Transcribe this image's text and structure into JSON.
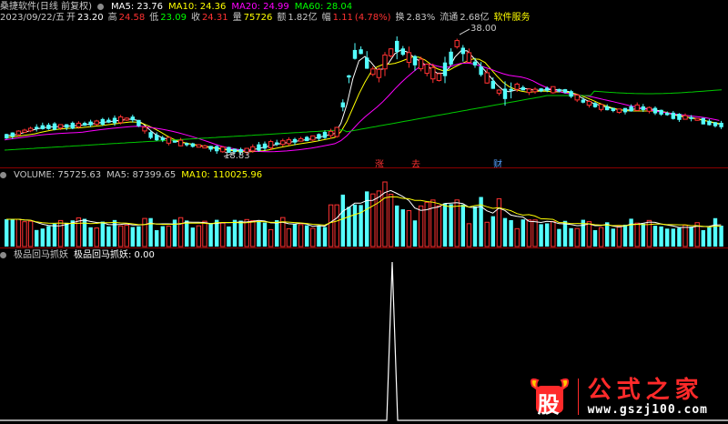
{
  "info_line": {
    "date": "2023/09/22/五",
    "open_label": "开",
    "open": "23.20",
    "high_label": "高",
    "high": "24.58",
    "low_label": "低",
    "low": "23.09",
    "close_label": "收",
    "close": "24.31",
    "vol_label": "量",
    "vol": "75726",
    "amount_label": "额",
    "amount": "1.82亿",
    "change_label": "幅",
    "change": "1.11",
    "change_pct": "(4.78%)",
    "turnover_label": "换",
    "turnover": "2.83%",
    "float_label": "流通",
    "float": "2.68亿",
    "service": "软件服务"
  },
  "price_panel": {
    "title": "桑捷软件(日线 前复权)",
    "ma": [
      {
        "label": "MA5: 23.76",
        "color": "#ffffff"
      },
      {
        "label": "MA10: 24.36",
        "color": "#ffff00"
      },
      {
        "label": "MA20: 24.99",
        "color": "#ff00ff"
      },
      {
        "label": "MA60: 28.04",
        "color": "#00ff00"
      }
    ],
    "high_mark": "38.00",
    "low_mark": "18.83",
    "event_markers": [
      "涨",
      "去",
      "财"
    ]
  },
  "volume_panel": {
    "label": "VOLUME: 75725.63",
    "ma5": "MA5: 87399.65",
    "ma10": "MA10: 110025.96"
  },
  "indicator_panel": {
    "name": "极品回马抓妖",
    "line_label": "极品回马抓妖: 0.00"
  },
  "logo": {
    "badge_char": "股",
    "title": "公式之家",
    "url": "www.gszj100.com"
  },
  "colors": {
    "up": "#ff3232",
    "down": "#54ffff",
    "ma5": "#ffffff",
    "ma10": "#ffff00",
    "ma20": "#ff00ff",
    "ma60": "#00c800",
    "panel_border": "#8b0000"
  }
}
